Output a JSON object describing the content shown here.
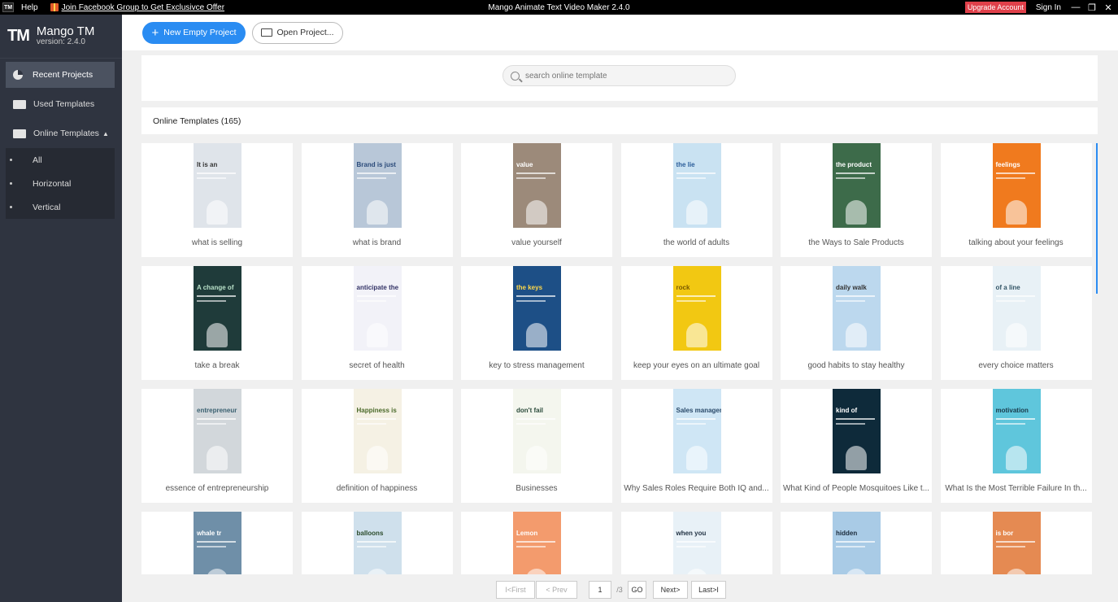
{
  "titlebar": {
    "logo": "TM",
    "help": "Help",
    "join": "Join Facebook Group to Get Exclusivce Offer",
    "title": "Mango Animate Text Video Maker 2.4.0",
    "upgrade": "Upgrade Account",
    "signin": "Sign In",
    "minimize": "—",
    "restore": "❐",
    "close": "✕"
  },
  "brand": {
    "mark": "TM",
    "name": "Mango TM",
    "version": "version: 2.4.0"
  },
  "sidebar": {
    "recent": "Recent Projects",
    "used": "Used Templates",
    "online": "Online Templates",
    "online_caret": "▲",
    "sub": [
      "All",
      "Horizontal",
      "Vertical"
    ]
  },
  "toolbar": {
    "new_plus": "+",
    "new_label": "New Empty Project",
    "open_label": "Open Project..."
  },
  "search": {
    "placeholder": "search online template"
  },
  "section": {
    "heading": "Online Templates (165)"
  },
  "templates": [
    {
      "label": "what is selling",
      "text": "It is an",
      "color": "#dfe4ea",
      "ink": "#333333"
    },
    {
      "label": "what is brand",
      "text": "Brand is just",
      "color": "#b8c7d8",
      "ink": "#2b4b7a"
    },
    {
      "label": "value yourself",
      "text": "value",
      "color": "#9c8a7a",
      "ink": "#ffffff"
    },
    {
      "label": "the world of adults",
      "text": "the lie",
      "color": "#c9e2f2",
      "ink": "#2c5e9a"
    },
    {
      "label": "the Ways to Sale Products",
      "text": "the product",
      "color": "#3d6b4a",
      "ink": "#ffffff"
    },
    {
      "label": "talking about your feelings",
      "text": "feelings",
      "color": "#f07a1e",
      "ink": "#ffffff"
    },
    {
      "label": "take a break",
      "text": "A change of",
      "color": "#1f3b3a",
      "ink": "#b8e0c8"
    },
    {
      "label": "secret of health",
      "text": "anticipate the",
      "color": "#f2f2f8",
      "ink": "#333366"
    },
    {
      "label": "key to stress management",
      "text": "the keys",
      "color": "#1d4f86",
      "ink": "#ffd84a"
    },
    {
      "label": "keep your eyes on an ultimate goal",
      "text": "rock",
      "color": "#f2c812",
      "ink": "#7a5a00"
    },
    {
      "label": "good habits to stay healthy",
      "text": "daily walk",
      "color": "#bcd8ee",
      "ink": "#333333"
    },
    {
      "label": "every choice matters",
      "text": "of a line",
      "color": "#e8f1f6",
      "ink": "#335566"
    },
    {
      "label": "essence of entrepreneurship",
      "text": "entrepreneur",
      "color": "#d2d7db",
      "ink": "#3a6070"
    },
    {
      "label": "definition of happiness",
      "text": "Happiness is",
      "color": "#f5f1e4",
      "ink": "#4a6a2a"
    },
    {
      "label": "Businesses",
      "text": "don't fail",
      "color": "#f4f6ee",
      "ink": "#2a4a3a"
    },
    {
      "label": "Why Sales Roles Require Both IQ and...",
      "text": "Sales manager",
      "color": "#cfe6f5",
      "ink": "#2a4a6a"
    },
    {
      "label": "What Kind of People Mosquitoes Like t...",
      "text": "kind of",
      "color": "#0e2a3a",
      "ink": "#ffffff"
    },
    {
      "label": "What Is the Most Terrible Failure In th...",
      "text": "motivation",
      "color": "#5fc6dc",
      "ink": "#1a3a4a"
    },
    {
      "label": "",
      "text": "whale tr",
      "color": "#6f8fa8",
      "ink": "#ffffff"
    },
    {
      "label": "",
      "text": "balloons",
      "color": "#cfe0ec",
      "ink": "#2a4a2a"
    },
    {
      "label": "",
      "text": "Lemon",
      "color": "#f39b6d",
      "ink": "#ffffff"
    },
    {
      "label": "",
      "text": "when you",
      "color": "#e8f1f7",
      "ink": "#223344"
    },
    {
      "label": "",
      "text": "hidden",
      "color": "#a9cbe6",
      "ink": "#1a2a3a"
    },
    {
      "label": "",
      "text": "is bor",
      "color": "#e58a52",
      "ink": "#ffffff"
    }
  ],
  "pager": {
    "first": "I<First",
    "prev": "< Prev",
    "current": "1",
    "total": "/3",
    "go": "GO",
    "next": "Next>",
    "last": "Last>I"
  },
  "colors": {
    "accent": "#2a8cf2",
    "sidebar": "#2f3440",
    "upgrade": "#e0404a"
  }
}
